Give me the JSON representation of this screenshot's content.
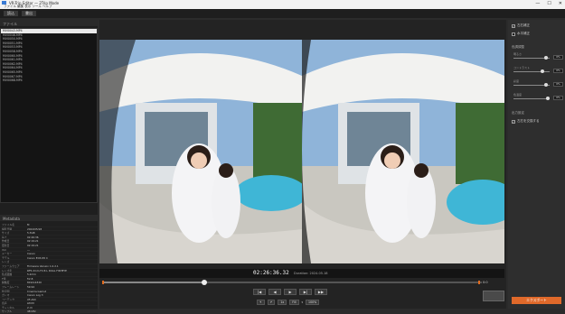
{
  "window": {
    "title": "VR-Trip Editor — 2Trip Mode",
    "menu": "ファイル 編集 表示 ツール ヘルプ",
    "buttons": [
      "—",
      "☐",
      "✕"
    ]
  },
  "toolbar": {
    "tabs": [
      "読込",
      "書出"
    ]
  },
  "files": {
    "header": "ファイル",
    "items": [
      "MVI0043.MP4",
      "MVI0046.MP4",
      "MVI0050.MP4",
      "MVI0051.MP4",
      "MVI0053.MP4",
      "MVI0058.MP4",
      "MVI0060.MP4",
      "MVI0061.MP4",
      "MVI0062.MP4",
      "MVI0064.MP4",
      "MVI0065.MP4",
      "MVI0067.MP4",
      "MVI0068.MP4"
    ],
    "selected_index": 0
  },
  "metadata": {
    "header": "Metadata",
    "rows": [
      {
        "k": "ファイル名",
        "v": "M"
      },
      {
        "k": "撮影日時",
        "v": "2024/05/18"
      },
      {
        "k": "サイズ",
        "v": "5.3GB"
      },
      {
        "k": "長さ",
        "v": "02:26:36"
      },
      {
        "k": "作成日",
        "v": "02:19:21"
      },
      {
        "k": "更新日",
        "v": "02:19:21"
      },
      {
        "k": "ISO",
        "v": "---"
      },
      {
        "k": "メーカー",
        "v": "Canon"
      },
      {
        "k": "モデル",
        "v": "Canon EOS R5 C"
      },
      {
        "k": "レンズ",
        "v": ""
      },
      {
        "k": "ファームウェア",
        "v": "Firmware Version 1.0.2.1"
      },
      {
        "k": "レンズ名",
        "v": "RF5.2mm F2.8 L DUAL FISHEYE"
      },
      {
        "k": "焦点距離",
        "v": "5.2mm"
      },
      {
        "k": "F値",
        "v": "f/2.8"
      },
      {
        "k": "解像度",
        "v": "8192x4320"
      },
      {
        "k": "フレームレート",
        "v": "59.94"
      },
      {
        "k": "色空間",
        "v": "Cinema Gamut"
      },
      {
        "k": "ガンマ",
        "v": "Canon Log 3"
      },
      {
        "k": "コーデック",
        "v": "XF-AVC"
      },
      {
        "k": "音声",
        "v": "LPCM"
      },
      {
        "k": "チャンネル",
        "v": "2 ch"
      },
      {
        "k": "サンプル",
        "v": "48 kHz"
      }
    ]
  },
  "player": {
    "timecode": "02:26:36.32",
    "duration": "Duration: 2024.05.18",
    "progress": 0.27,
    "in_mark": 0.0,
    "out_mark": 0.995,
    "seek_label": "0:0",
    "controls": [
      "|◀",
      "◀",
      "▶",
      "▶|",
      "▶▶"
    ],
    "controls2": [
      "↰",
      "↱",
      "1x",
      "Fill",
      "100%"
    ],
    "controls2_sep": "▾"
  },
  "adjust": {
    "check1": {
      "label": "左右補正",
      "checked": true
    },
    "check2": {
      "label": "水平補正",
      "checked": false
    },
    "section1": "色調調整",
    "sliders": [
      {
        "label": "明るさ",
        "value": "0%",
        "pos": 0.9
      },
      {
        "label": "コントラスト",
        "value": "0%",
        "pos": 0.8
      },
      {
        "label": "彩度",
        "value": "0%",
        "pos": 0.9
      },
      {
        "label": "色温度",
        "value": "0%",
        "pos": 0.95
      }
    ],
    "section2": "出力設定",
    "check3": {
      "label": "左右を交換する",
      "checked": true
    },
    "export": "エクスポート",
    "accent": "#e0692a"
  }
}
